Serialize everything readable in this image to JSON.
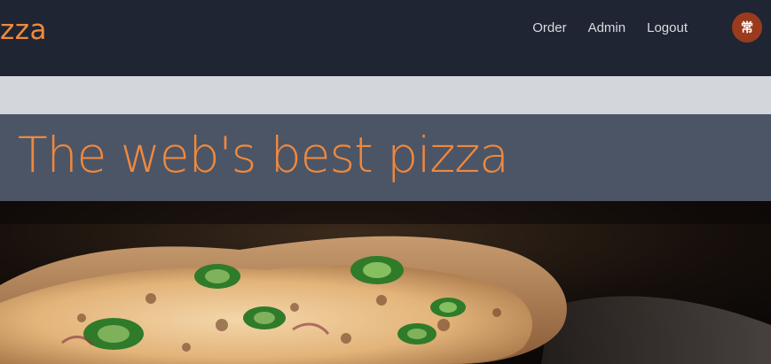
{
  "header": {
    "brand": "zza",
    "nav": [
      {
        "label": "Order"
      },
      {
        "label": "Admin"
      },
      {
        "label": "Logout"
      }
    ],
    "avatar_glyph": "常"
  },
  "hero": {
    "title": "The web's best pizza"
  },
  "colors": {
    "header_bg": "#1f2533",
    "accent_orange": "#f0883d",
    "hero_band": "#4b5566",
    "strip": "#d3d6db",
    "avatar_bg": "#9a3b1e"
  },
  "icons": {
    "avatar": "user-avatar-icon"
  }
}
